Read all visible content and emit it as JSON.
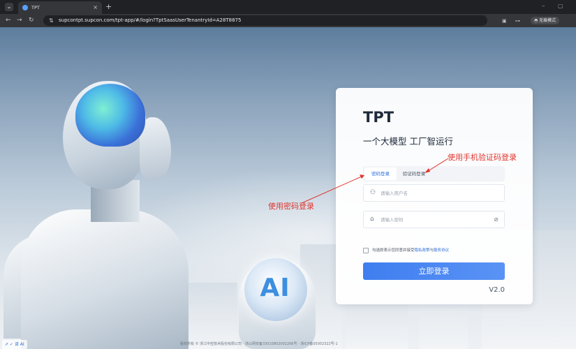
{
  "browser": {
    "tab_title": "TPT",
    "tab_close": "×",
    "tab_new": "+",
    "tab_menu": "⌄",
    "url": "supcontpt.supcon.com/tpt-app/#/login?TptSaasUserTenantryId=A28T8875",
    "incognito_label": "无痕模式",
    "window_minimize": "–",
    "window_restore": "▢"
  },
  "login": {
    "brand": "TPT",
    "slogan": "一个大模型 工厂智运行",
    "tab_password": "密码登录",
    "tab_sms": "验证码登录",
    "username_placeholder": "请输入用户名",
    "password_placeholder": "请输入密码",
    "agree_text": "勾选即表示您同意并接受",
    "agree_privacy": "隐私政策",
    "agree_and": "与",
    "agree_service": "服务协议",
    "login_button": "立即登录",
    "version": "V2.0"
  },
  "annotations": {
    "sms_note": "使用手机验证码登录",
    "password_note": "使用密码登录"
  },
  "hero": {
    "ai_text": "AI"
  },
  "footer": {
    "tools": "⇗ ✓ 译 AI",
    "copyright": "版权所有 © 浙江中控技术股份有限公司 · 浙公网安备33010802002206号 · 浙ICP备05002322号-1"
  },
  "icons": {
    "user": "user-icon",
    "lock": "lock-icon",
    "eye": "eye-off-icon",
    "back": "back-icon",
    "forward": "forward-icon",
    "reload": "reload-icon"
  },
  "colors": {
    "accent": "#3f7ef0",
    "annotation": "#e0362e",
    "link": "#2f6fdc"
  }
}
